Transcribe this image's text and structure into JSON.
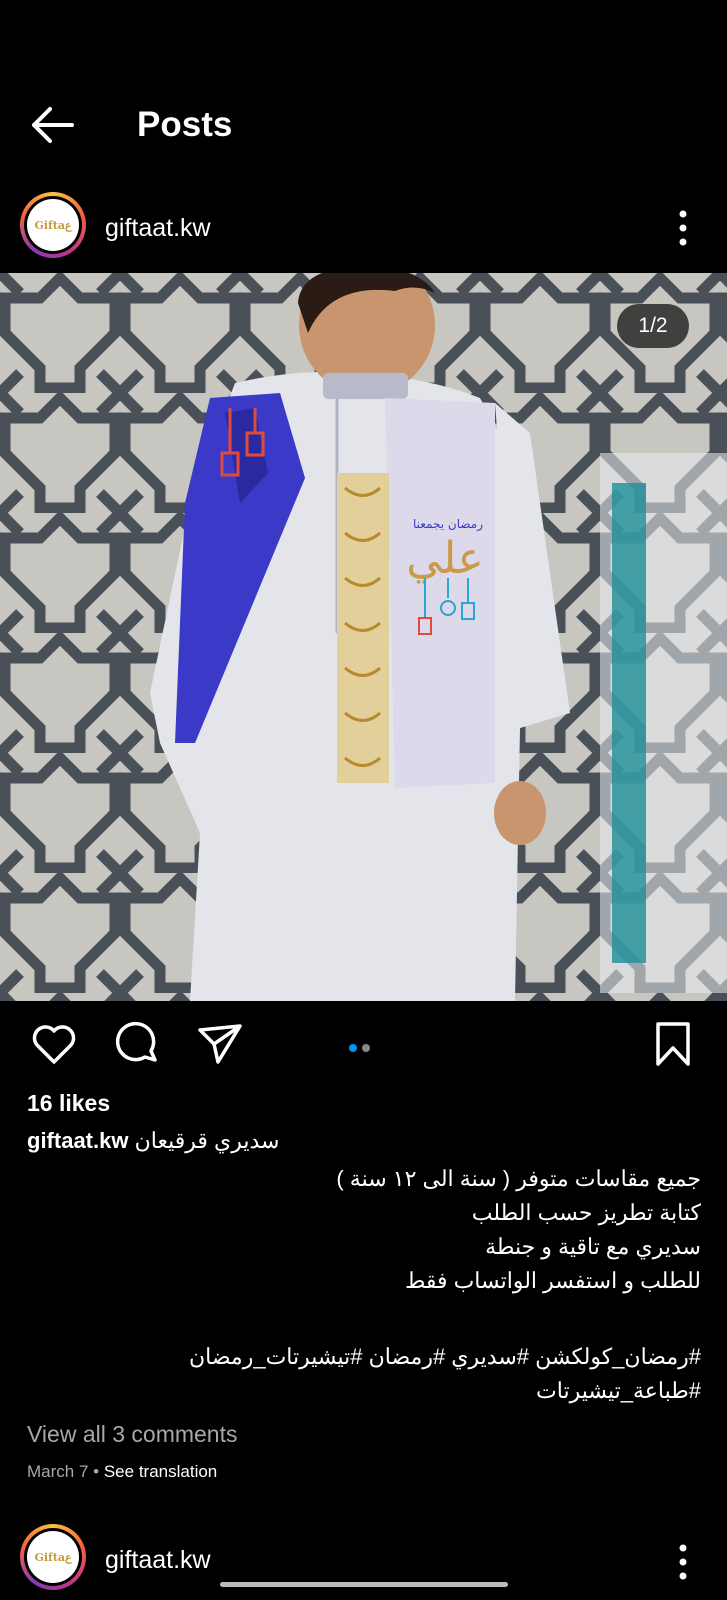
{
  "header": {
    "title": "Posts"
  },
  "post": {
    "username": "giftaat.kw",
    "avatar_text": "Giftaع",
    "image_counter": "1/2",
    "likes": "16 likes",
    "caption_first": "سديري قرقيعان",
    "caption_lines": [
      "جميع مقاسات متوفر ( سنة الى ١٢ سنة )",
      "كتابة تطريز حسب الطلب",
      "سديري مع تاقية و جنطة",
      "للطلب و استفسر الواتساب فقط"
    ],
    "hashtags_line1": "#رمضان_كولكشن #سديري #رمضان #تيشيرتات_رمضان",
    "hashtags_line2": "#طباعة_تيشيرتات",
    "view_comments": "View all 3 comments",
    "date": "March 7",
    "separator": "•",
    "see_translation": "See translation",
    "embroidery_text": "علي",
    "embroidery_sub": "رمضان يجمعنا"
  },
  "next_post": {
    "username": "giftaat.kw"
  },
  "colors": {
    "accent": "#0095f6",
    "background": "#000000"
  }
}
